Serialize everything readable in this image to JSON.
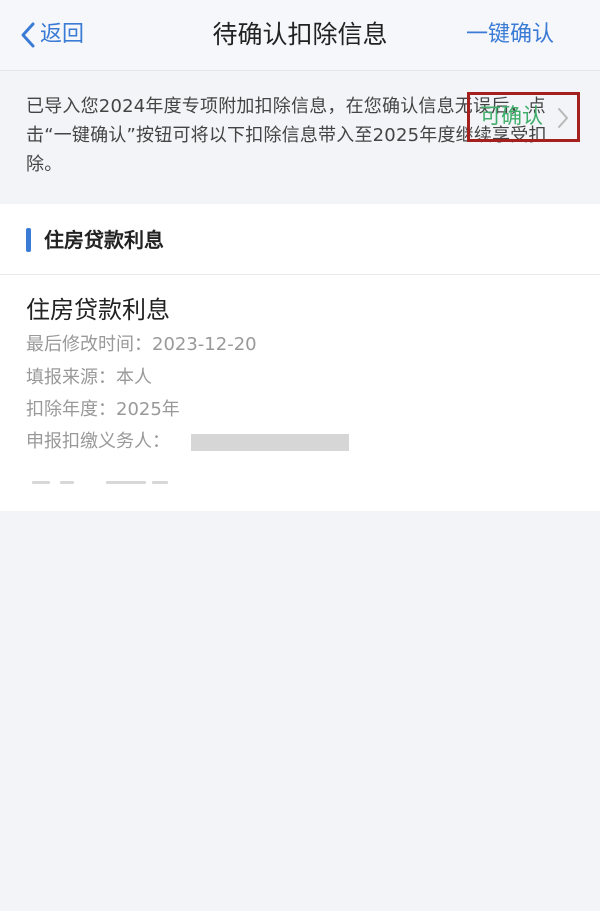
{
  "navbar": {
    "back_label": "返回",
    "title": "待确认扣除信息",
    "confirm_all_label": "一键确认"
  },
  "notice": {
    "text": "已导入您2024年度专项附加扣除信息，在您确认信息无误后，点击“一键确认”按钮可将以下扣除信息带入至2025年度继续享受扣除。"
  },
  "section": {
    "title": "住房贷款利息"
  },
  "card": {
    "title": "住房贷款利息",
    "rows": [
      {
        "label": "最后修改时间：",
        "value": "2023-12-20"
      },
      {
        "label": "填报来源：",
        "value": "本人"
      },
      {
        "label": "扣除年度：",
        "value": "2025年"
      },
      {
        "label": "申报扣缴义务人：",
        "value": ""
      }
    ],
    "status_label": "可确认"
  },
  "colors": {
    "accent_blue": "#3a7bd5",
    "status_green": "#3fae6a",
    "highlight_red": "#a3201d",
    "page_background": "#f3f4f8"
  },
  "icons": {
    "back": "chevron-left-icon",
    "status": "chevron-right-icon"
  }
}
